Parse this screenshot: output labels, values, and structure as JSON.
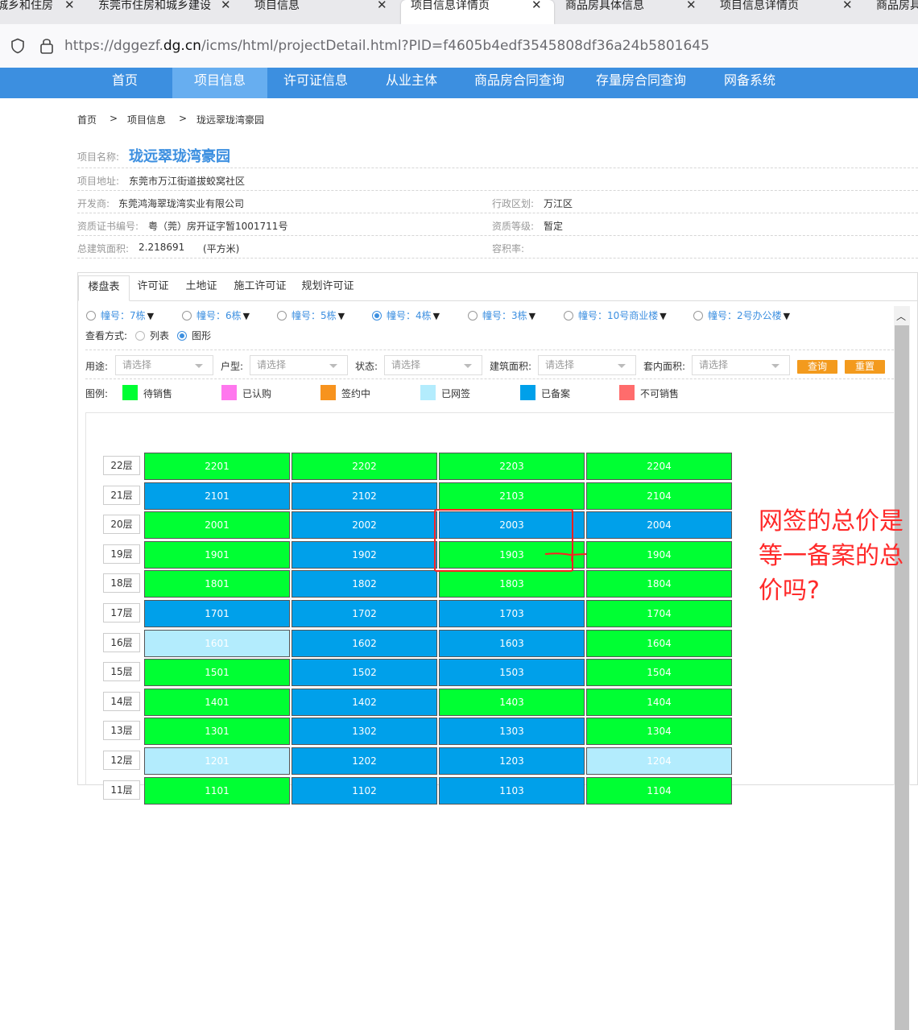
{
  "browser": {
    "tabs": [
      {
        "title": "城乡和住房"
      },
      {
        "title": "东莞市住房和城乡建设"
      },
      {
        "title": "项目信息"
      },
      {
        "title": "项目信息详情页"
      },
      {
        "title": "商品房具体信息"
      },
      {
        "title": "项目信息详情页"
      },
      {
        "title": "商品房具"
      }
    ],
    "url_prefix": "https://dggezf.",
    "url_domain": "dg.cn",
    "url_suffix": "/icms/html/projectDetail.html?PID=f4605b4edf3545808df36a24b5801645"
  },
  "nav": {
    "items": [
      "首页",
      "项目信息",
      "许可证信息",
      "从业主体",
      "商品房合同查询",
      "存量房合同查询",
      "网备系统"
    ],
    "active": "项目信息"
  },
  "breadcrumb": {
    "home": "首页",
    "sep": ">",
    "section": "项目信息",
    "current": "珑远翠珑湾豪园"
  },
  "project": {
    "name_label": "项目名称:",
    "name": "珑远翠珑湾豪园",
    "address_label": "项目地址:",
    "address": "东莞市万江街道拔蛟窝社区",
    "developer_label": "开发商:",
    "developer": "东莞鸿海翠珑湾实业有限公司",
    "district_label": "行政区划:",
    "district": "万江区",
    "cert_label": "资质证书编号:",
    "cert": "粤（莞）房开证字暂1001711号",
    "level_label": "资质等级:",
    "level": "暂定",
    "area_label": "总建筑面积:",
    "area": "2.218691",
    "area_unit": "(平方米)",
    "ratio_label": "容积率:"
  },
  "panel": {
    "tabs": [
      "楼盘表",
      "许可证",
      "土地证",
      "施工许可证",
      "规划许可证"
    ],
    "buildings": [
      {
        "label": "幢号：7栋",
        "selected": false
      },
      {
        "label": "幢号：6栋",
        "selected": false
      },
      {
        "label": "幢号：5栋",
        "selected": false
      },
      {
        "label": "幢号：4栋",
        "selected": true
      },
      {
        "label": "幢号：3栋",
        "selected": false
      },
      {
        "label": "幢号：10号商业楼",
        "selected": false
      },
      {
        "label": "幢号：2号办公楼",
        "selected": false
      }
    ],
    "view_label": "查看方式:",
    "view_list": "列表",
    "view_graph": "图形",
    "filters": [
      {
        "label": "用途:",
        "placeholder": "请选择"
      },
      {
        "label": "户型:",
        "placeholder": "请选择"
      },
      {
        "label": "状态:",
        "placeholder": "请选择"
      },
      {
        "label": "建筑面积:",
        "placeholder": "请选择"
      },
      {
        "label": "套内面积:",
        "placeholder": "请选择"
      }
    ],
    "query_btn": "查询",
    "reset_btn": "重置",
    "legend_title": "图例:",
    "legend": [
      {
        "label": "待销售",
        "color": "#00ff33"
      },
      {
        "label": "已认购",
        "color": "#ff77ee"
      },
      {
        "label": "签约中",
        "color": "#f7931e"
      },
      {
        "label": "已网签",
        "color": "#b3ecfd"
      },
      {
        "label": "已备案",
        "color": "#00a0ea"
      },
      {
        "label": "不可销售",
        "color": "#ff6c6c"
      }
    ]
  },
  "grid": {
    "floors": [
      {
        "floor": "22层",
        "units": [
          [
            "2201",
            "g"
          ],
          [
            "2202",
            "g"
          ],
          [
            "2203",
            "g"
          ],
          [
            "2204",
            "g"
          ]
        ]
      },
      {
        "floor": "21层",
        "units": [
          [
            "2101",
            "b"
          ],
          [
            "2102",
            "b"
          ],
          [
            "2103",
            "g"
          ],
          [
            "2104",
            "g"
          ]
        ]
      },
      {
        "floor": "20层",
        "units": [
          [
            "2001",
            "g"
          ],
          [
            "2002",
            "b"
          ],
          [
            "2003",
            "b"
          ],
          [
            "2004",
            "b"
          ]
        ]
      },
      {
        "floor": "19层",
        "units": [
          [
            "1901",
            "g"
          ],
          [
            "1902",
            "b"
          ],
          [
            "1903",
            "g"
          ],
          [
            "1904",
            "g"
          ]
        ]
      },
      {
        "floor": "18层",
        "units": [
          [
            "1801",
            "g"
          ],
          [
            "1802",
            "b"
          ],
          [
            "1803",
            "g"
          ],
          [
            "1804",
            "g"
          ]
        ]
      },
      {
        "floor": "17层",
        "units": [
          [
            "1701",
            "b"
          ],
          [
            "1702",
            "b"
          ],
          [
            "1703",
            "b"
          ],
          [
            "1704",
            "g"
          ]
        ]
      },
      {
        "floor": "16层",
        "units": [
          [
            "1601",
            "l"
          ],
          [
            "1602",
            "b"
          ],
          [
            "1603",
            "b"
          ],
          [
            "1604",
            "g"
          ]
        ]
      },
      {
        "floor": "15层",
        "units": [
          [
            "1501",
            "g"
          ],
          [
            "1502",
            "b"
          ],
          [
            "1503",
            "b"
          ],
          [
            "1504",
            "g"
          ]
        ]
      },
      {
        "floor": "14层",
        "units": [
          [
            "1401",
            "g"
          ],
          [
            "1402",
            "b"
          ],
          [
            "1403",
            "g"
          ],
          [
            "1404",
            "g"
          ]
        ]
      },
      {
        "floor": "13层",
        "units": [
          [
            "1301",
            "g"
          ],
          [
            "1302",
            "b"
          ],
          [
            "1303",
            "b"
          ],
          [
            "1304",
            "g"
          ]
        ]
      },
      {
        "floor": "12层",
        "units": [
          [
            "1201",
            "l"
          ],
          [
            "1202",
            "b"
          ],
          [
            "1203",
            "b"
          ],
          [
            "1204",
            "l"
          ]
        ]
      },
      {
        "floor": "11层",
        "units": [
          [
            "1101",
            "g"
          ],
          [
            "1102",
            "b"
          ],
          [
            "1103",
            "b"
          ],
          [
            "1104",
            "g"
          ]
        ]
      }
    ],
    "status_colors": {
      "g": "#00ff33",
      "b": "#00a0ea",
      "l": "#b3ecfd"
    }
  },
  "annotation": {
    "text": "网签的总价是等一备案的总价吗?"
  }
}
